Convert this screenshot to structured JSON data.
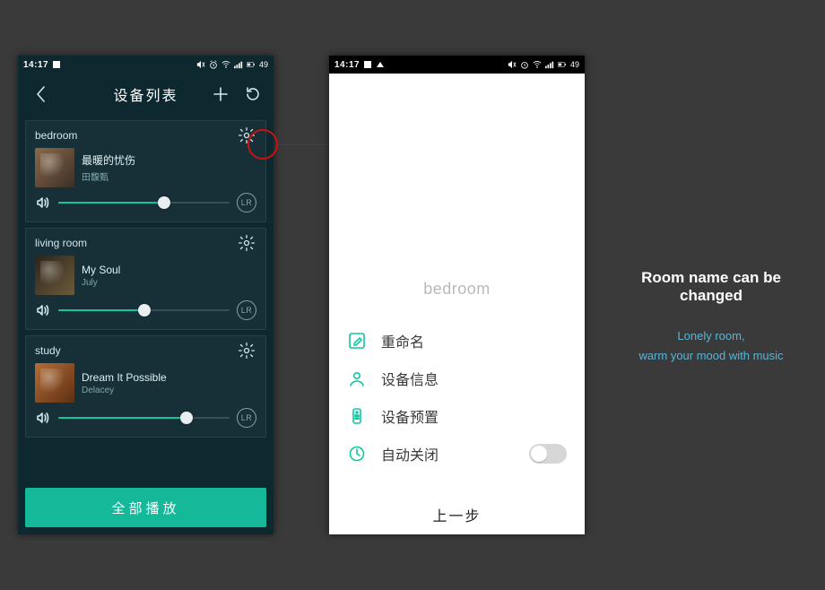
{
  "statusbar": {
    "time": "14:17",
    "battery": "49"
  },
  "left_phone": {
    "title": "设备列表",
    "play_all": "全部播放",
    "rooms": [
      {
        "name": "bedroom",
        "track": "最暖的忧伤",
        "artist": "田馥甄",
        "volume_pct": 62,
        "lr": "LR"
      },
      {
        "name": "living room",
        "track": "My Soul",
        "artist": "July",
        "volume_pct": 50,
        "lr": "LR"
      },
      {
        "name": "study",
        "track": "Dream It Possible",
        "artist": "Delacey",
        "volume_pct": 75,
        "lr": "LR"
      }
    ]
  },
  "right_phone": {
    "selected_room": "bedroom",
    "items": {
      "rename": "重命名",
      "info": "设备信息",
      "preset": "设备预置",
      "auto_off": "自动关闭"
    },
    "back": "上一步"
  },
  "caption": {
    "title": "Room name can be changed",
    "line_a": "Lonely room,",
    "line_b": "warm your mood with music"
  }
}
